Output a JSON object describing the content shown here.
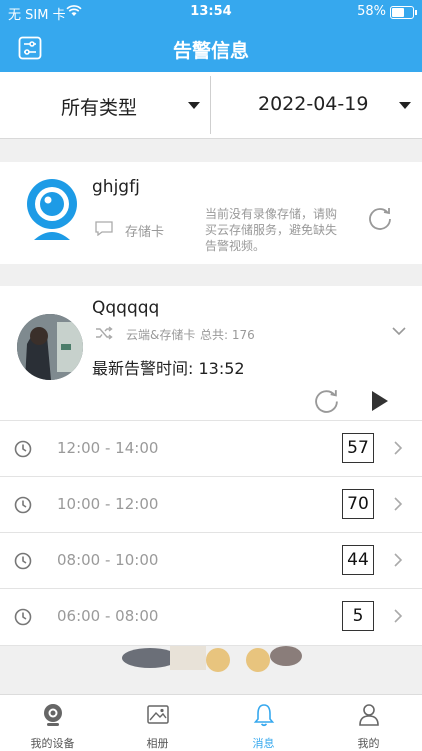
{
  "status_bar": {
    "carrier": "无 SIM 卡",
    "time": "13:54",
    "battery": "58%",
    "battery_level": 0.58
  },
  "header": {
    "title": "告警信息"
  },
  "filters": {
    "type": "所有类型",
    "date": "2022-04-19"
  },
  "devices": [
    {
      "name": "ghjgfj",
      "storage_label": "存储卡",
      "notice": [
        "当前没有录像存储，请购",
        "买云存储服务，避免缺失",
        "告警视频。"
      ]
    },
    {
      "name": "Qqqqqq",
      "storage_label": "云端&存储卡",
      "total_label": "总共: 176",
      "latest_label": "最新告警时间: 13:52",
      "slots": [
        {
          "range": "12:00 - 14:00",
          "count": "57"
        },
        {
          "range": "10:00 - 12:00",
          "count": "70"
        },
        {
          "range": "08:00 - 10:00",
          "count": "44"
        },
        {
          "range": "06:00 - 08:00",
          "count": "5"
        }
      ]
    }
  ],
  "tabs": [
    {
      "label": "我的设备",
      "icon": "camera-icon"
    },
    {
      "label": "相册",
      "icon": "album-icon"
    },
    {
      "label": "消息",
      "icon": "bell-icon"
    },
    {
      "label": "我的",
      "icon": "person-icon"
    }
  ],
  "colors": {
    "accent": "#36a8ee",
    "text": "#222222",
    "muted": "#999999"
  }
}
